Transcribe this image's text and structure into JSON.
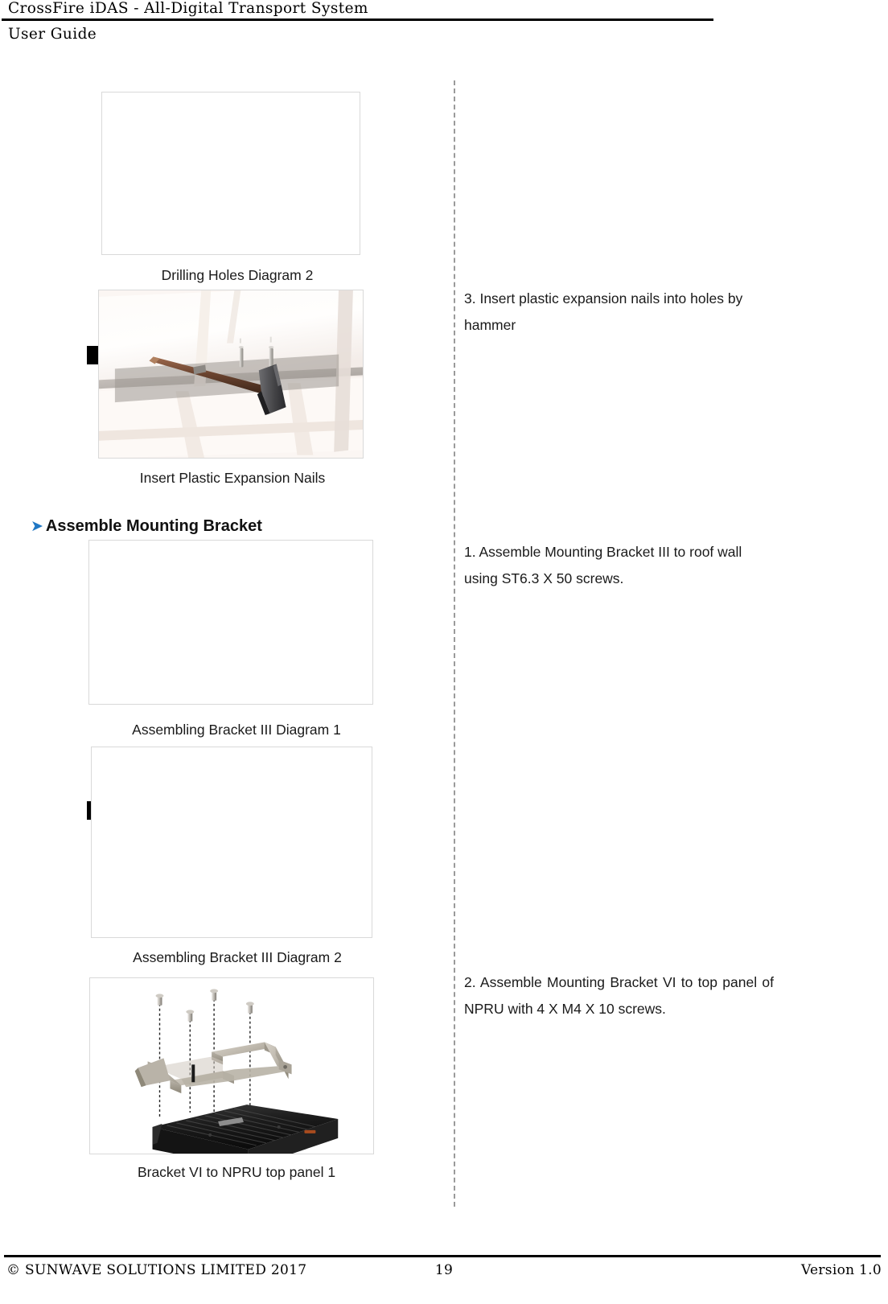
{
  "header": {
    "title": "CrossFire iDAS - All-Digital Transport System",
    "subtitle": "User Guide"
  },
  "left_column": {
    "figures": [
      {
        "name": "drilling-holes-diagram-2",
        "caption": "Drilling Holes Diagram 2",
        "redacted": true,
        "content": "blank"
      },
      {
        "name": "insert-plastic-expansion-nails",
        "caption": "Insert Plastic Expansion Nails",
        "redacted": false,
        "content": "photo-ceiling-hammer-nails"
      },
      {
        "name": "assembling-bracket-iii-diagram-1",
        "caption": "Assembling Bracket III Diagram 1",
        "redacted": true,
        "content": "blank"
      },
      {
        "name": "assembling-bracket-iii-diagram-2",
        "caption": "Assembling Bracket III Diagram 2",
        "redacted": false,
        "content": "blank"
      },
      {
        "name": "bracket-vi-to-npru-top-panel-1",
        "caption": "Bracket VI to NPRU top panel 1",
        "redacted": false,
        "content": "photo-bracket-over-npru"
      }
    ],
    "section_heading": {
      "bullet": "arrow-bullet-icon",
      "text": "Assemble Mounting Bracket"
    }
  },
  "right_column": {
    "steps": [
      {
        "text": "3. Insert plastic expansion nails into holes by hammer"
      },
      {
        "text": "1. Assemble Mounting Bracket III to roof wall using ST6.3 X 50 screws."
      },
      {
        "text": "2. Assemble Mounting Bracket VI to top panel of NPRU with 4 X M4 X 10 screws."
      }
    ]
  },
  "footer": {
    "copyright": "© SUNWAVE SOLUTIONS LIMITED 2017",
    "page_number": "19",
    "version": "Version 1.0"
  },
  "colors": {
    "accent_blue": "#1f77c4",
    "rule_black": "#000000",
    "figure_border": "#d9d9d9",
    "divider_gray": "#9a9a9a"
  }
}
